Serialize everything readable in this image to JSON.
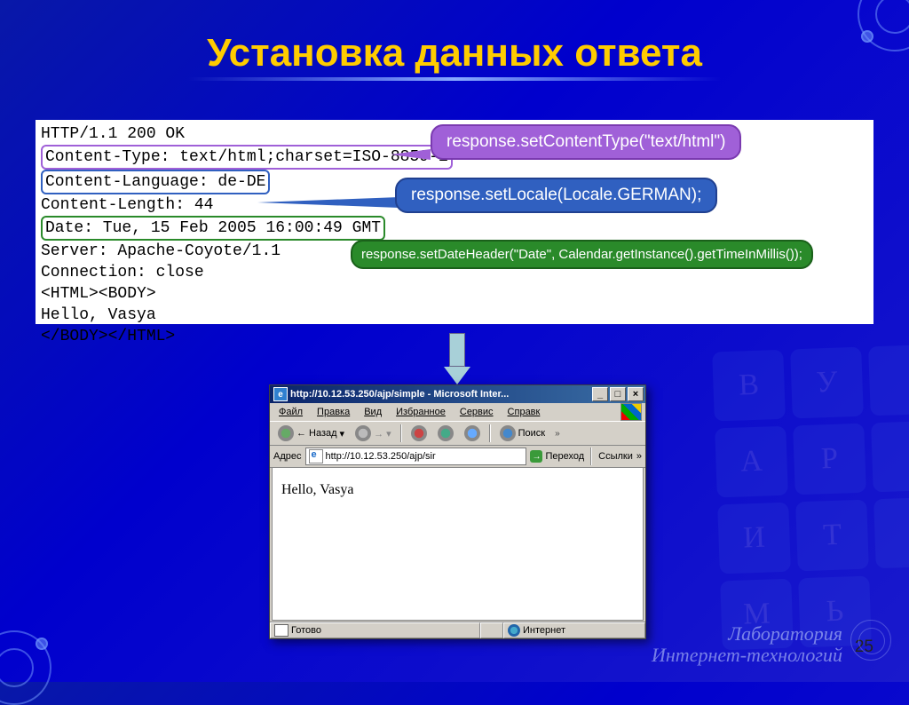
{
  "slide": {
    "title": "Установка данных ответа",
    "page_number": "25"
  },
  "code": {
    "line1": "HTTP/1.1 200 OK",
    "line2": "Content-Type: text/html;charset=ISO-8859-1",
    "line3": "Content-Language: de-DE",
    "line4": "Content-Length: 44",
    "line5": "Date: Tue, 15 Feb 2005 16:00:49 GMT",
    "line6": "Server: Apache-Coyote/1.1",
    "line7": "Connection: close",
    "line8": "",
    "line9": "<HTML><BODY>",
    "line10": "Hello, Vasya",
    "line11": "</BODY></HTML>"
  },
  "callouts": {
    "purple": "response.setContentType(\"text/html\")",
    "blue": "response.setLocale(Locale.GERMAN);",
    "green": "response.setDateHeader(\"Date\",  Calendar.getInstance().getTimeInMillis());"
  },
  "ie": {
    "title": "http://10.12.53.250/ajp/simple - Microsoft Inter...",
    "menu": {
      "file": "Файл",
      "edit": "Правка",
      "view": "Вид",
      "fav": "Избранное",
      "tools": "Сервис",
      "help": "Справк"
    },
    "toolbar": {
      "back": "Назад",
      "search": "Поиск"
    },
    "address": {
      "label": "Адрес",
      "value": "http://10.12.53.250/ajp/sir",
      "go": "Переход",
      "links": "Ссылки"
    },
    "content": "Hello, Vasya",
    "status": {
      "ready": "Готово",
      "zone": "Интернет"
    }
  },
  "footer": {
    "line1": "Лаборатория",
    "line2": "Интернет-технологий"
  },
  "keys": [
    "В",
    "У",
    "А",
    "Р",
    "И",
    "Т",
    "М",
    "Ь"
  ]
}
